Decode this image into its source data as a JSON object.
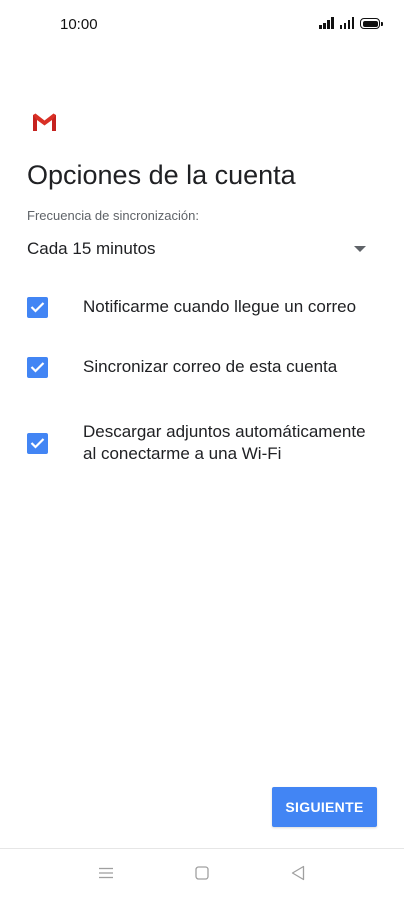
{
  "status_bar": {
    "time": "10:00"
  },
  "header": {
    "logo_icon": "gmail-logo-icon",
    "title": "Opciones de la cuenta"
  },
  "sync": {
    "label": "Frecuencia de sincronización:",
    "value": "Cada 15 minutos"
  },
  "options": [
    {
      "label": "Notificarme cuando llegue un correo",
      "checked": true
    },
    {
      "label": "Sincronizar correo de esta cuenta",
      "checked": true
    },
    {
      "label": "Descargar adjuntos automáticamente al conectarme a una Wi-Fi",
      "checked": true
    }
  ],
  "actions": {
    "next_label": "SIGUIENTE"
  },
  "nav_bar": {
    "icons": [
      "menu-icon",
      "home-square-icon",
      "back-triangle-icon"
    ]
  },
  "colors": {
    "accent": "#4285f4",
    "text_primary": "#202124",
    "text_secondary": "#5f6368",
    "gmail_red": "#d93025"
  }
}
